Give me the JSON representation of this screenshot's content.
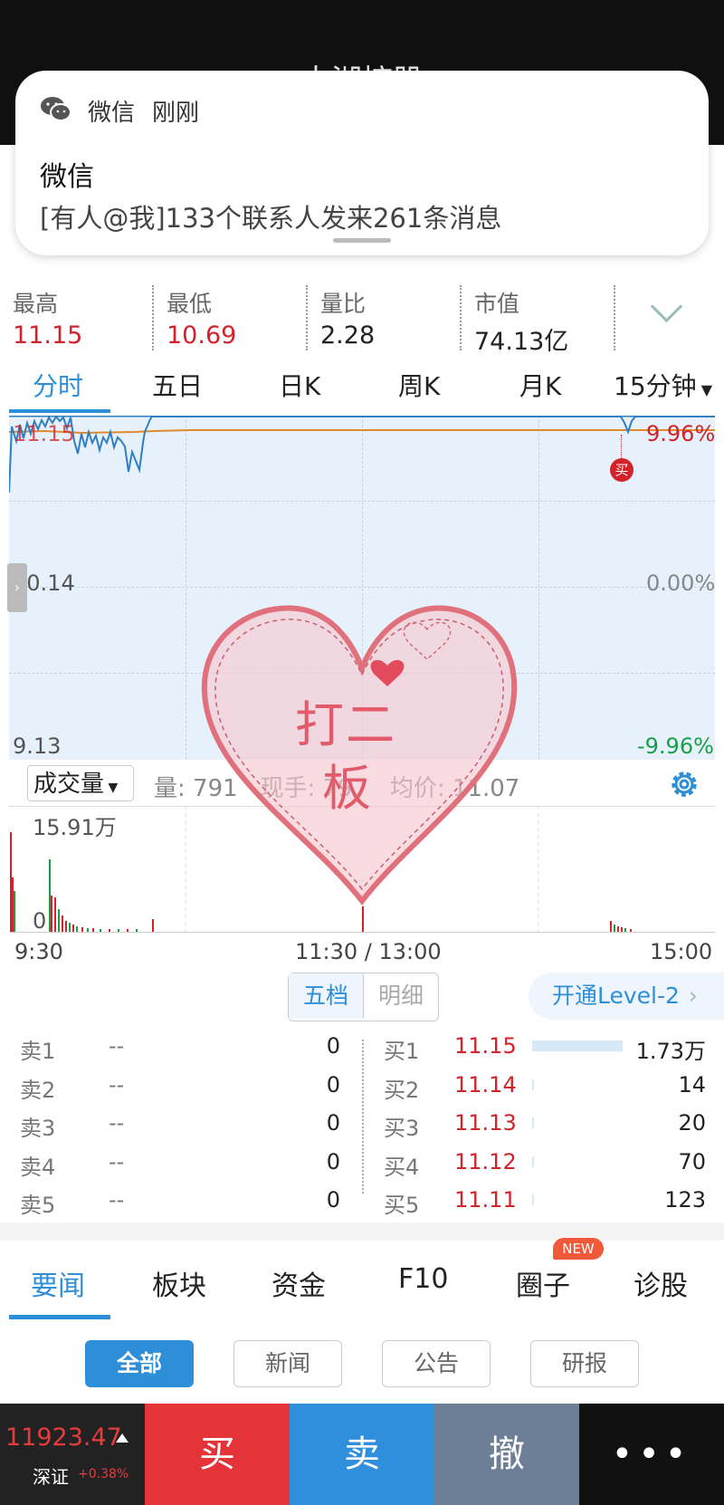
{
  "status_bar": {
    "title": "大湖控股"
  },
  "notification": {
    "app": "微信",
    "time": "刚刚",
    "title": "微信",
    "body": "[有人@我]133个联系人发来261条消息"
  },
  "stats": [
    {
      "label": "最高",
      "value": "11.15"
    },
    {
      "label": "最低",
      "value": "10.69"
    },
    {
      "label": "量比",
      "value": "2.28"
    },
    {
      "label": "市值",
      "value": "74.13亿"
    }
  ],
  "tabs": [
    "分时",
    "五日",
    "日K",
    "周K",
    "月K",
    "15分钟"
  ],
  "chart": {
    "y_labels": [
      "11.15",
      "10.14",
      "9.13"
    ],
    "pct_labels": [
      "9.96%",
      "0.00%",
      "-9.96%"
    ],
    "buy_marker": "买",
    "colors": {
      "up": "#d2232a",
      "down": "#1a9e4a",
      "price_line": "#2e7fc4",
      "avg_line": "#e08a2e"
    }
  },
  "volume": {
    "selector": "成交量",
    "info": "量: 791   现手: 79     均价: 11.07",
    "max_label": "15.91万",
    "min_label": "0",
    "time_labels": [
      "9:30",
      "11:30 / 13:00",
      "15:00"
    ]
  },
  "orderbook": {
    "seg_a": "五档",
    "seg_b": "明细",
    "level2": "开通Level-2",
    "asks": [
      {
        "label": "卖1",
        "price": "--",
        "qty": "0"
      },
      {
        "label": "卖2",
        "price": "--",
        "qty": "0"
      },
      {
        "label": "卖3",
        "price": "--",
        "qty": "0"
      },
      {
        "label": "卖4",
        "price": "--",
        "qty": "0"
      },
      {
        "label": "卖5",
        "price": "--",
        "qty": "0"
      }
    ],
    "bids": [
      {
        "label": "买1",
        "price": "11.15",
        "qty": "1.73万",
        "fill": 1.0
      },
      {
        "label": "买2",
        "price": "11.14",
        "qty": "14",
        "fill": 0.0
      },
      {
        "label": "买3",
        "price": "11.13",
        "qty": "20",
        "fill": 0.0
      },
      {
        "label": "买4",
        "price": "11.12",
        "qty": "70",
        "fill": 0.0
      },
      {
        "label": "买5",
        "price": "11.11",
        "qty": "123",
        "fill": 0.01
      }
    ]
  },
  "news_tabs": [
    "要闻",
    "板块",
    "资金",
    "F10",
    "圈子",
    "诊股"
  ],
  "new_badge": "NEW",
  "chips": [
    "全部",
    "新闻",
    "公告",
    "研报"
  ],
  "action_bar": {
    "index_value": "11923.47",
    "index_name": "深证",
    "index_pct": "+0.38%",
    "buy": "买",
    "sell": "卖",
    "cancel": "撤",
    "more": "•••"
  },
  "sticker": {
    "line1": "打二",
    "line2": "板"
  }
}
